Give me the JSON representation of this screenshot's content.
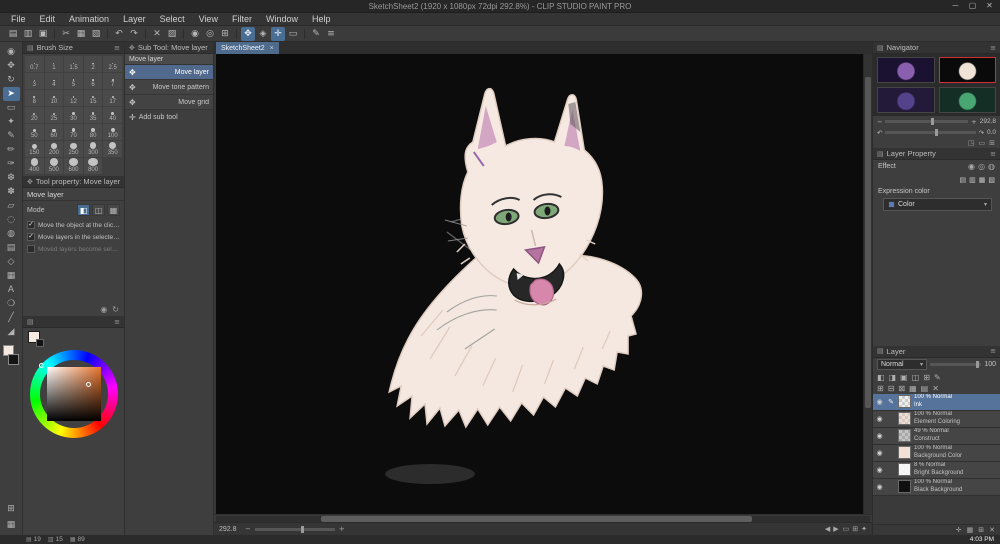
{
  "colors": {
    "accent_blue": "#4a6d94",
    "selection_blue": "#56749b",
    "tab_blue": "#4e6b8c",
    "canvas_black": "#0c0c0c",
    "fox_cream": "#f5e9e1",
    "fox_pink": "#cf9ec0",
    "eye_green": "#7fa878",
    "thumb_highlight_red": "#d03030"
  },
  "window": {
    "title": "SketchSheet2 (1920 x 1080px 72dpi 292.8%) - CLIP STUDIO PAINT PRO"
  },
  "glyphs": {
    "min": "─",
    "max": "▢",
    "close": "✕",
    "tab_close": "×",
    "arrow_down": "▾",
    "add": "✛",
    "move": "✥",
    "check": "✓",
    "menu": "≡",
    "collapse": "⊟",
    "panel": "▤",
    "minus": "−",
    "plus": "+",
    "undo": "↶",
    "redo": "↷",
    "left": "◀",
    "right": "▶"
  },
  "menu": [
    "File",
    "Edit",
    "Animation",
    "Layer",
    "Select",
    "View",
    "Filter",
    "Window",
    "Help"
  ],
  "command_bar": [
    {
      "g": "▤",
      "n": "new-file"
    },
    {
      "g": "▥",
      "n": "open-file"
    },
    {
      "g": "▣",
      "n": "save"
    },
    {
      "sep": true
    },
    {
      "g": "✂",
      "n": "cut"
    },
    {
      "g": "▦",
      "n": "copy"
    },
    {
      "g": "▧",
      "n": "paste"
    },
    {
      "sep": true
    },
    {
      "g": "↶",
      "n": "undo"
    },
    {
      "g": "↷",
      "n": "redo"
    },
    {
      "sep": true
    },
    {
      "g": "✕",
      "n": "clear"
    },
    {
      "g": "▨",
      "n": "fill"
    },
    {
      "sep": true
    },
    {
      "g": "◉",
      "n": "zoom-in"
    },
    {
      "g": "◎",
      "n": "zoom-out"
    },
    {
      "g": "⊞",
      "n": "grid"
    },
    {
      "sep": true
    },
    {
      "g": "✥",
      "n": "snap-move",
      "active": true
    },
    {
      "g": "◈",
      "n": "snap-ruler"
    },
    {
      "g": "✛",
      "n": "snap-special",
      "active": true
    },
    {
      "g": "▭",
      "n": "select-area"
    },
    {
      "sep": true
    },
    {
      "g": "✎",
      "n": "quick-pen"
    },
    {
      "g": "≡",
      "n": "workspace-settings"
    }
  ],
  "tools": [
    {
      "g": "◉",
      "n": "tool-zoom"
    },
    {
      "g": "✥",
      "n": "tool-move"
    },
    {
      "g": "↻",
      "n": "tool-rotate"
    },
    {
      "g": "➤",
      "n": "tool-operation",
      "selected": true
    },
    {
      "g": "▭",
      "n": "tool-selection"
    },
    {
      "g": "✦",
      "n": "tool-auto-select"
    },
    {
      "g": "✎",
      "n": "tool-pen"
    },
    {
      "g": "✏",
      "n": "tool-pencil"
    },
    {
      "g": "✑",
      "n": "tool-brush"
    },
    {
      "g": "❆",
      "n": "tool-airbrush"
    },
    {
      "g": "✽",
      "n": "tool-decoration"
    },
    {
      "g": "▱",
      "n": "tool-eraser"
    },
    {
      "g": "◌",
      "n": "tool-blend"
    },
    {
      "g": "◍",
      "n": "tool-fill"
    },
    {
      "g": "▤",
      "n": "tool-gradient"
    },
    {
      "g": "◇",
      "n": "tool-figure"
    },
    {
      "g": "▦",
      "n": "tool-frame"
    },
    {
      "g": "A",
      "n": "tool-text"
    },
    {
      "g": "❍",
      "n": "tool-balloon"
    },
    {
      "g": "╱",
      "n": "tool-line-correction"
    },
    {
      "g": "◢",
      "n": "tool-ruler"
    }
  ],
  "panels": {
    "brush": {
      "title": "Brush Size",
      "sizes": [
        "0.7",
        "1",
        "1.5",
        "2",
        "2.5",
        "3",
        "4",
        "5",
        "6",
        "7",
        "8",
        "10",
        "12",
        "15",
        "17",
        "20",
        "25",
        "30",
        "35",
        "40",
        "50",
        "60",
        "70",
        "80",
        "100",
        "150",
        "200",
        "250",
        "300",
        "350",
        "400",
        "500",
        "600",
        "800"
      ]
    },
    "subtool": {
      "title": "Sub Tool: Move layer",
      "tab": "Move layer",
      "items": [
        {
          "label": "Move layer",
          "selected": true
        },
        {
          "label": "Move tone pattern"
        },
        {
          "label": "Move grid"
        }
      ],
      "add_label": "Add sub tool"
    },
    "toolprop": {
      "title": "Tool property: Move layer",
      "subtitle": "Move layer",
      "mode_label": "Mode",
      "mode_buttons": [
        "◧",
        "◫",
        "▦"
      ],
      "checkboxes": [
        {
          "label": "Move the object at the clicked poi",
          "checked": true
        },
        {
          "label": "Move layers in the selected area",
          "checked": true
        },
        {
          "label": "Moved layers become selected",
          "checked": false,
          "disabled": true
        }
      ],
      "footer_icons": [
        "◉",
        "↻"
      ]
    },
    "navigator": {
      "title": "Navigator",
      "zoom_value": "292.8",
      "rotation_value": "0.0",
      "thumbs": [
        {
          "name": "nav-thumb-purple-character",
          "bg": "#1a1230",
          "accent": "#8a5fb0"
        },
        {
          "name": "nav-thumb-fox-sketch",
          "bg": "#0a0a0a",
          "accent": "#efe3d8",
          "current": true
        },
        {
          "name": "nav-thumb-dark-purple",
          "bg": "#221a38",
          "accent": "#54428a"
        },
        {
          "name": "nav-thumb-green-figure",
          "bg": "#142e26",
          "accent": "#49a572"
        }
      ],
      "footer_icons": [
        "◳",
        "▭",
        "⊞"
      ]
    },
    "layerprop": {
      "title": "Layer Property",
      "effect_label": "Effect",
      "effect_icons": [
        "◉",
        "◎",
        "◍"
      ],
      "sub_icons": [
        "▤",
        "▥",
        "▦",
        "▧"
      ],
      "expression_label": "Expression color",
      "dropdown_value": "Color"
    },
    "layers": {
      "title": "Layer",
      "blend_mode": "Normal",
      "opacity_value": "100",
      "icons_row1": [
        "◧",
        "◨",
        "▣",
        "◫",
        "⊞",
        "✎"
      ],
      "icons_row2": [
        "⊞",
        "⊟",
        "⊠",
        "▦",
        "▤",
        "✕"
      ],
      "footer_icons": [
        "✛",
        "▦",
        "⊞",
        "✕"
      ],
      "rows": [
        {
          "opacity": "100",
          "mode": "Normal",
          "name": "Ink",
          "selected": true,
          "thumb": "rgba(250,248,246,0.3)"
        },
        {
          "opacity": "100",
          "mode": "Normal",
          "name": "Element Coloring",
          "thumb": "rgba(240,214,198,0.55)"
        },
        {
          "opacity": "49",
          "mode": "Normal",
          "name": "Construct",
          "thumb": "rgba(150,150,150,0.45)"
        },
        {
          "opacity": "100",
          "mode": "Normal",
          "name": "Background Color",
          "thumb": "rgba(243,224,213,1)"
        },
        {
          "opacity": "8",
          "mode": "Normal",
          "name": "Bright Background",
          "thumb": "rgba(250,250,250,0.9)"
        },
        {
          "opacity": "100",
          "mode": "Normal",
          "name": "Black Background",
          "thumb": "rgba(16,16,16,1)"
        }
      ]
    }
  },
  "canvas": {
    "tab_label": "SketchSheet2",
    "zoom_value": "292.8",
    "nav_icons": [
      "◀",
      "▶"
    ],
    "fit_icons": [
      "▭",
      "⊞",
      "✦"
    ]
  },
  "status": {
    "items": [
      {
        "icon": "▤",
        "value": "19"
      },
      {
        "icon": "▥",
        "value": "15"
      },
      {
        "icon": "▦",
        "value": "89"
      }
    ],
    "time": "4:03 PM"
  }
}
